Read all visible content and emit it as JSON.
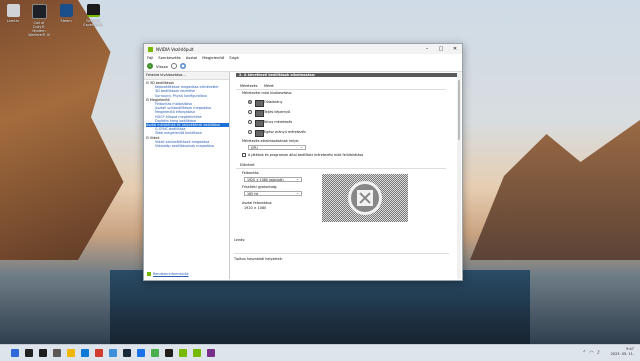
{
  "desktop": {
    "icons": [
      {
        "label": "Lomtár",
        "color": "#d0d4d8"
      },
      {
        "label": "Call of Duty® Modern Warfare® III",
        "color": "#1d2026"
      },
      {
        "label": "Steam",
        "color": "#1b4f8c"
      },
      {
        "label": "GeForce Experience",
        "color": "#1a1a1a"
      }
    ]
  },
  "window": {
    "title": "NVIDIA Vezérlőpult",
    "menu": [
      "Fájl",
      "Szerkesztés",
      "Asztal",
      "Megjelenítő",
      "Súgó"
    ],
    "toolbar": {
      "back_label": "Vissza"
    }
  },
  "left_panel": {
    "header": "Feladat kiválasztása...",
    "tree": [
      {
        "text": "3D beállítások",
        "type": "cat"
      },
      {
        "text": "Képbeállítások megadása előnézettel",
        "type": "sub"
      },
      {
        "text": "3D beállítások kezelése",
        "type": "sub"
      },
      {
        "text": "Surround, PhysX konfigurálása",
        "type": "sub"
      },
      {
        "text": "Megjelenítő",
        "type": "cat"
      },
      {
        "text": "Felbontás módosítása",
        "type": "sub"
      },
      {
        "text": "Asztali színbeállítások megadása",
        "type": "sub"
      },
      {
        "text": "Megjelenítő elforgatása",
        "type": "sub"
      },
      {
        "text": "HDCP állapot megtekintése",
        "type": "sub"
      },
      {
        "text": "Digitális hang beállítása",
        "type": "sub"
      },
      {
        "text": "Asztal méretének és helyzetének beállítása",
        "type": "sel"
      },
      {
        "text": "G-SYNC beállítása",
        "type": "sub"
      },
      {
        "text": "Több megjelenítő beállítása",
        "type": "sub"
      },
      {
        "text": "Videó",
        "type": "cat"
      },
      {
        "text": "Videó színbeállítások megadása",
        "type": "sub"
      },
      {
        "text": "Videokép beállításainak megadása",
        "type": "sub"
      }
    ],
    "footer": "Rendszerinformációk"
  },
  "content": {
    "section_header": "2. A következő beállítások alkalmazása:",
    "tabs_label": "Méretezés",
    "tab2": "Méret",
    "scaling_mode_label": "Méretezési mód kiválasztása:",
    "options": [
      {
        "label": "Oldalarány",
        "selected": true
      },
      {
        "label": "Teljes képernyő",
        "selected": false
      },
      {
        "label": "Nincs méretezés",
        "selected": false
      },
      {
        "label": "Egész arányú méretezés",
        "selected": false
      }
    ],
    "perform_on_label": "Méretezés alkalmazásának helye:",
    "perform_on_value": "GPU",
    "override_label": "A játékok és programok által beállított méretezési mód felülbírálása",
    "preview_label": "Előnézet",
    "resolution_label": "Felbontás:",
    "resolution_value": "1920 × 1080 (ajánlott)",
    "refresh_label": "Frissítési gyakoriság:",
    "refresh_value": "165 Hz",
    "desktop_res_label": "Asztal felbontása:",
    "desktop_res_value": "1920 × 1080",
    "description_label": "Leírás:",
    "usage_label": "Tipikus használati helyzetek:"
  },
  "taskbar": {
    "time": "9:47",
    "date": "2023. 05. 11."
  }
}
